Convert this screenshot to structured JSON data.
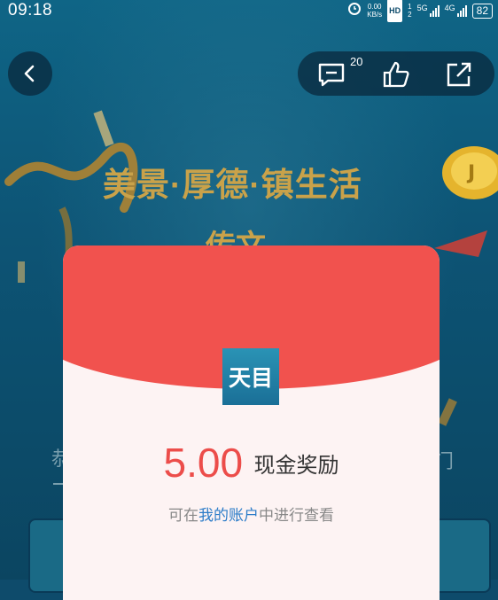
{
  "status_bar": {
    "time": "09:18",
    "net_speed": "0.00",
    "net_unit": "KB/s",
    "hd": "HD",
    "sim1": "1",
    "sim2": "2",
    "net1": "5G",
    "net2": "4G",
    "battery": "82"
  },
  "toolbar": {
    "comment_count": "20",
    "icons": [
      "back-icon",
      "comment-icon",
      "thumbs-up-icon",
      "share-icon"
    ]
  },
  "background": {
    "headline": "美景·厚德·镇生活",
    "subhead": "传文",
    "behind_left": "恭",
    "behind_right": "门"
  },
  "red_packet": {
    "logo_text": "天目",
    "amount": "5.00",
    "amount_label": "现金奖励",
    "hint_prefix": "可在",
    "hint_link": "我的账户",
    "hint_suffix": "中进行查看",
    "colors": {
      "top": "#f1524e",
      "amount": "#ec4d4a",
      "link": "#2c7cc8",
      "logo": "#1a6f97"
    }
  }
}
